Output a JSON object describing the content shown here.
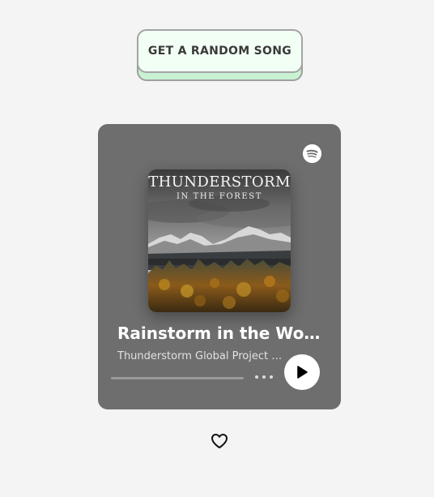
{
  "random_button": {
    "label": "GET A RANDOM SONG"
  },
  "player": {
    "logo_icon": "spotify-icon",
    "album": {
      "title": "THUNDERSTORM",
      "subtitle": "IN THE FOREST"
    },
    "track_title": "Rainstorm in the Wood...",
    "artist": "Thunderstorm Global Project f...",
    "progress": 0,
    "more_icon": "more-dots-icon",
    "play_icon": "play-icon"
  },
  "favorite": {
    "icon": "heart-icon"
  },
  "colors": {
    "background": "#f4f4f4",
    "card": "#6e6e6e",
    "button_face": "#f2fff4",
    "button_shadow": "#c8f2d2"
  }
}
